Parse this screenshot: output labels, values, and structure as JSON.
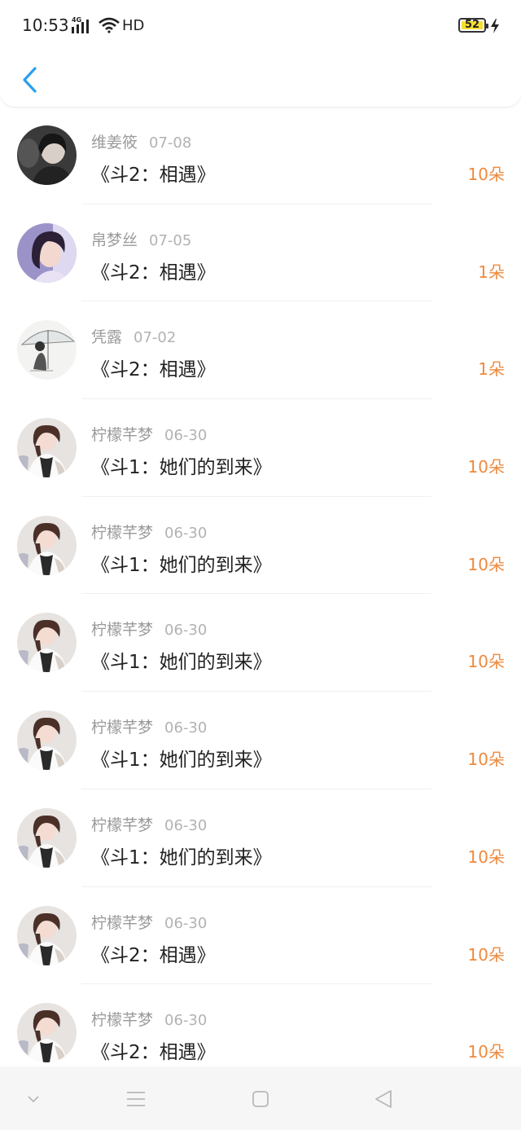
{
  "status_bar": {
    "time": "10:53",
    "network": "4G",
    "hd": "HD",
    "battery": "52"
  },
  "nav": {
    "back_icon": "chevron-left-icon"
  },
  "colors": {
    "accent": "#2a9ff0",
    "count": "#ee8a3e",
    "name": "#9a9a9a",
    "title": "#222222"
  },
  "gifts": [
    {
      "name": "维姜筱",
      "date": "07-08",
      "title": "《斗2：相遇》",
      "count": "10朵",
      "avatar": "dark-portrait"
    },
    {
      "name": "帛梦丝",
      "date": "07-05",
      "title": "《斗2：相遇》",
      "count": "1朵",
      "avatar": "purple-portrait"
    },
    {
      "name": "凭露",
      "date": "07-02",
      "title": "《斗2：相遇》",
      "count": "1朵",
      "avatar": "umbrella-sketch"
    },
    {
      "name": "柠檬芊梦",
      "date": "06-30",
      "title": "《斗1：她们的到来》",
      "count": "10朵",
      "avatar": "girl-portrait"
    },
    {
      "name": "柠檬芊梦",
      "date": "06-30",
      "title": "《斗1：她们的到来》",
      "count": "10朵",
      "avatar": "girl-portrait"
    },
    {
      "name": "柠檬芊梦",
      "date": "06-30",
      "title": "《斗1：她们的到来》",
      "count": "10朵",
      "avatar": "girl-portrait"
    },
    {
      "name": "柠檬芊梦",
      "date": "06-30",
      "title": "《斗1：她们的到来》",
      "count": "10朵",
      "avatar": "girl-portrait"
    },
    {
      "name": "柠檬芊梦",
      "date": "06-30",
      "title": "《斗1：她们的到来》",
      "count": "10朵",
      "avatar": "girl-portrait"
    },
    {
      "name": "柠檬芊梦",
      "date": "06-30",
      "title": "《斗2：相遇》",
      "count": "10朵",
      "avatar": "girl-portrait"
    },
    {
      "name": "柠檬芊梦",
      "date": "06-30",
      "title": "《斗2：相遇》",
      "count": "10朵",
      "avatar": "girl-portrait"
    }
  ],
  "system_nav": {
    "left": "chevron-down-icon",
    "menu": "menu-icon",
    "home": "home-square-icon",
    "back": "back-triangle-icon"
  }
}
